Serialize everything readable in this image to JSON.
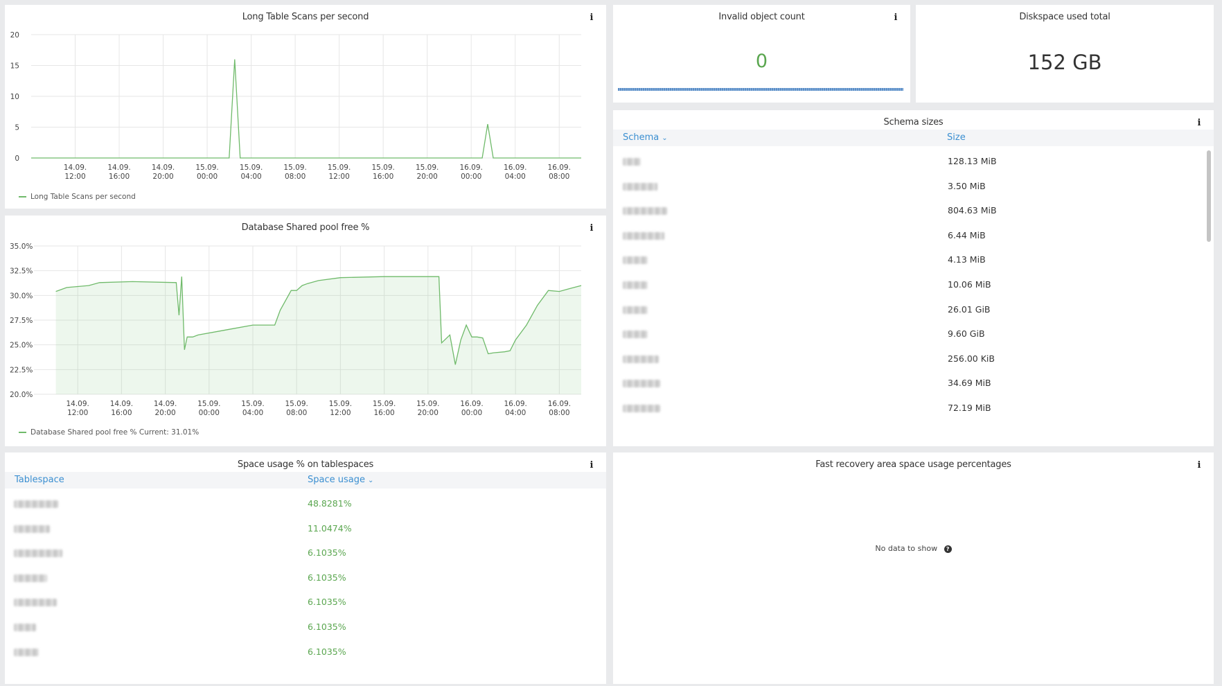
{
  "panels": {
    "long_scans": {
      "title": "Long Table Scans per second",
      "legend": "Long Table Scans per second"
    },
    "invalid_objects": {
      "title": "Invalid object count",
      "value": "0",
      "value_color": "#5aa64f"
    },
    "diskspace": {
      "title": "Diskspace used total",
      "value": "152 GB"
    },
    "shared_pool": {
      "title": "Database Shared pool free %",
      "legend": "Database Shared pool free %  Current: 31.01%"
    },
    "schema_sizes": {
      "title": "Schema sizes",
      "columns": [
        "Schema",
        "Size"
      ],
      "rows": [
        {
          "schema": "",
          "size": "128.13 MiB"
        },
        {
          "schema": "",
          "size": "3.50 MiB"
        },
        {
          "schema": "",
          "size": "804.63 MiB"
        },
        {
          "schema": "",
          "size": "6.44 MiB"
        },
        {
          "schema": "",
          "size": "4.13 MiB"
        },
        {
          "schema": "",
          "size": "10.06 MiB"
        },
        {
          "schema": "",
          "size": "26.01 GiB"
        },
        {
          "schema": "",
          "size": "9.60 GiB"
        },
        {
          "schema": "",
          "size": "256.00 KiB"
        },
        {
          "schema": "",
          "size": "34.69 MiB"
        },
        {
          "schema": "",
          "size": "72.19 MiB"
        }
      ]
    },
    "tablespaces": {
      "title": "Space usage % on tablespaces",
      "columns": [
        "Tablespace",
        "Space usage"
      ],
      "value_color": "#5aa64f",
      "rows": [
        {
          "tablespace": "",
          "usage": "48.8281%"
        },
        {
          "tablespace": "",
          "usage": "11.0474%"
        },
        {
          "tablespace": "",
          "usage": "6.1035%"
        },
        {
          "tablespace": "",
          "usage": "6.1035%"
        },
        {
          "tablespace": "",
          "usage": "6.1035%"
        },
        {
          "tablespace": "",
          "usage": "6.1035%"
        },
        {
          "tablespace": "",
          "usage": "6.1035%"
        }
      ]
    },
    "recovery": {
      "title": "Fast recovery area space usage percentages",
      "empty_text": "No data to show"
    }
  },
  "icons": {
    "info": "info-icon",
    "help": "question-circle-icon",
    "sort": "chevron-down-icon"
  },
  "colors": {
    "series_green": "#6fba6a",
    "link_blue": "#3b8fd1",
    "value_green": "#5aa64f"
  },
  "chart_data": [
    {
      "type": "line",
      "series": [
        {
          "name": "Long Table Scans per second",
          "x": [
            "14.09. 08:00",
            "14.09. 22:00",
            "14.09. 23:00",
            "14.09. 23:30",
            "15.09. 00:00",
            "15.09. 01:00",
            "15.09. 02:00",
            "15.09. 02:30",
            "15.09. 03:00",
            "15.09. 04:00",
            "15.09. 12:00",
            "15.09. 20:00",
            "16.09. 00:00",
            "16.09. 01:00",
            "16.09. 01:30",
            "16.09. 02:00",
            "16.09. 03:00",
            "16.09. 10:00"
          ],
          "values": [
            0,
            0,
            0,
            0,
            0,
            0,
            0,
            16,
            0,
            0,
            0,
            0,
            0,
            0,
            5.5,
            0,
            0,
            0
          ]
        }
      ],
      "ylim": [
        0,
        20
      ],
      "yticks": [
        "0",
        "5",
        "10",
        "15",
        "20"
      ],
      "xticks": [
        "14.09.\n12:00",
        "14.09.\n16:00",
        "14.09.\n20:00",
        "15.09.\n00:00",
        "15.09.\n04:00",
        "15.09.\n08:00",
        "15.09.\n12:00",
        "15.09.\n16:00",
        "15.09.\n20:00",
        "16.09.\n00:00",
        "16.09.\n04:00",
        "16.09.\n08:00"
      ],
      "grid": true,
      "legend": "bottom-left"
    },
    {
      "type": "area",
      "series": [
        {
          "name": "Database Shared pool free %",
          "x": [
            "14.09. 10:00",
            "14.09. 11:00",
            "14.09. 13:00",
            "14.09. 14:00",
            "14.09. 17:00",
            "14.09. 21:00",
            "14.09. 21:15",
            "14.09. 21:30",
            "14.09. 21:45",
            "14.09. 22:00",
            "14.09. 22:30",
            "14.09. 23:00",
            "15.09. 01:00",
            "15.09. 02:00",
            "15.09. 04:00",
            "15.09. 06:00",
            "15.09. 06:30",
            "15.09. 07:30",
            "15.09. 08:00",
            "15.09. 08:30",
            "15.09. 09:00",
            "15.09. 10:00",
            "15.09. 12:00",
            "15.09. 16:00",
            "15.09. 20:00",
            "15.09. 21:00",
            "15.09. 21:15",
            "15.09. 22:00",
            "15.09. 22:30",
            "15.09. 23:00",
            "15.09. 23:30",
            "16.09. 00:00",
            "16.09. 00:30",
            "16.09. 01:00",
            "16.09. 01:30",
            "16.09. 02:00",
            "16.09. 03:00",
            "16.09. 03:30",
            "16.09. 04:00",
            "16.09. 05:00",
            "16.09. 06:00",
            "16.09. 07:00",
            "16.09. 08:00",
            "16.09. 09:00",
            "16.09. 10:00"
          ],
          "values": [
            30.4,
            30.8,
            31.0,
            31.3,
            31.4,
            31.3,
            28.0,
            31.9,
            24.5,
            25.8,
            25.8,
            26.0,
            26.4,
            26.6,
            27.0,
            27.0,
            28.5,
            30.5,
            30.5,
            31.0,
            31.2,
            31.5,
            31.8,
            31.9,
            31.9,
            31.9,
            25.2,
            26.0,
            23.0,
            25.5,
            27.0,
            25.8,
            25.8,
            25.7,
            24.1,
            24.2,
            24.3,
            24.4,
            25.5,
            27.0,
            29.0,
            30.5,
            30.4,
            30.7,
            31.0
          ]
        }
      ],
      "ylim": [
        20,
        35
      ],
      "yticks": [
        "20.0%",
        "22.5%",
        "25.0%",
        "27.5%",
        "30.0%",
        "32.5%",
        "35.0%"
      ],
      "xticks": [
        "14.09.\n12:00",
        "14.09.\n16:00",
        "14.09.\n20:00",
        "15.09.\n00:00",
        "15.09.\n04:00",
        "15.09.\n08:00",
        "15.09.\n12:00",
        "15.09.\n16:00",
        "15.09.\n20:00",
        "16.09.\n00:00",
        "16.09.\n04:00",
        "16.09.\n08:00"
      ],
      "grid": true,
      "legend": "bottom-left"
    }
  ]
}
